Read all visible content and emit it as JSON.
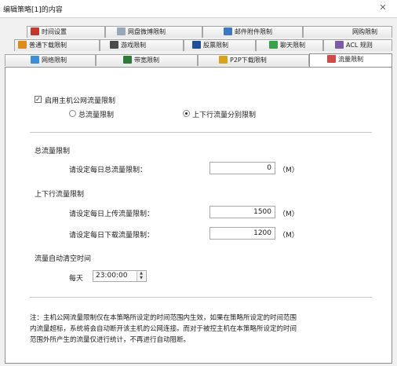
{
  "window": {
    "title": "编辑策略[1]的内容",
    "close_glyph": "✕"
  },
  "tabs": {
    "row1": [
      {
        "label": "时间设置",
        "icon": "clock-icon",
        "color": "#c0392b"
      },
      {
        "label": "网盘微博限制",
        "icon": "cloud-icon",
        "color": "#9aa7b8"
      },
      {
        "label": "邮件附件限制",
        "icon": "mail-icon",
        "color": "#3c78c8"
      },
      {
        "label": "网购限制",
        "icon": "",
        "color": ""
      }
    ],
    "row2": [
      {
        "label": "普通下载限制",
        "icon": "download-icon",
        "color": "#e08a1e"
      },
      {
        "label": "游戏限制",
        "icon": "game-icon",
        "color": "#4a4a4a"
      },
      {
        "label": "股票限制",
        "icon": "stock-icon",
        "color": "#1f4e9a"
      },
      {
        "label": "聊天限制",
        "icon": "chat-icon",
        "color": "#3aa04a"
      },
      {
        "label": "ACL 规则",
        "icon": "acl-icon",
        "color": "#7a5ca8"
      }
    ],
    "row3": [
      {
        "label": "网络限制",
        "icon": "network-icon",
        "color": "#3a8fd6"
      },
      {
        "label": "带宽限制",
        "icon": "bandwidth-icon",
        "color": "#2d7a3a"
      },
      {
        "label": "P2P下载限制",
        "icon": "p2p-icon",
        "color": "#d9a21b"
      },
      {
        "label": "流量限制",
        "icon": "traffic-icon",
        "color": "#d24a4a"
      }
    ]
  },
  "panel": {
    "enable_label": "启用主机公网流量限制",
    "enable_checked": true,
    "radio_total": "总流量限制",
    "radio_split": "上下行流量分别限制",
    "selected_mode": "split",
    "total_section": "总流量限制",
    "total_daily_label": "请设定每日总流量限制：",
    "total_daily_value": "0",
    "split_section": "上下行流量限制",
    "upload_label": "请设定每日上传流量限制：",
    "upload_value": "1500",
    "download_label": "请设定每日下载流量限制：",
    "download_value": "1200",
    "unit": "（M）",
    "auto_clear_section": "流量自动清空时间",
    "daily_label": "每天",
    "clear_time": "23:00:00",
    "note_line1": "注：主机公网流量限制仅在本策略所设定的时间范围内生效，如果在策略所设定的时间范围",
    "note_line2": "内流量超标，系统将会自动断开该主机的公网连接。而对于被控主机在本策略所设定的时间",
    "note_line3": "范围外所产生的流量仅进行统计，不再进行自动阻断。"
  }
}
